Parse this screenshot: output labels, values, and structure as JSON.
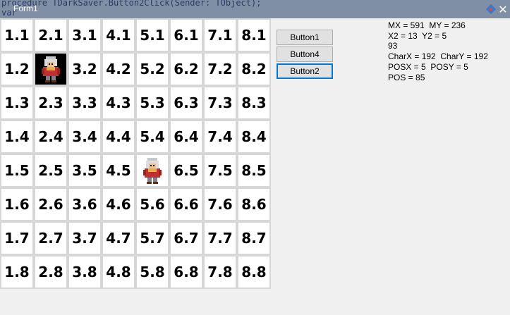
{
  "window": {
    "title": "Form1",
    "background_code": "procedure TDarkSaver.Button2Click(Sender: TObject);\nvar",
    "close_glyph": "✕"
  },
  "grid": {
    "cells": [
      "1.1",
      "2.1",
      "3.1",
      "4.1",
      "5.1",
      "6.1",
      "7.1",
      "8.1",
      "1.2",
      "",
      "3.2",
      "4.2",
      "5.2",
      "6.2",
      "7.2",
      "8.2",
      "1.3",
      "2.3",
      "3.3",
      "4.3",
      "5.3",
      "6.3",
      "7.3",
      "8.3",
      "1.4",
      "2.4",
      "3.4",
      "4.4",
      "5.4",
      "6.4",
      "7.4",
      "8.4",
      "1.5",
      "2.5",
      "3.5",
      "4.5",
      "",
      "6.5",
      "7.5",
      "8.5",
      "1.6",
      "2.6",
      "3.6",
      "4.6",
      "5.6",
      "6.6",
      "7.6",
      "8.6",
      "1.7",
      "2.7",
      "3.7",
      "4.7",
      "5.7",
      "6.7",
      "7.7",
      "8.7",
      "1.8",
      "2.8",
      "3.8",
      "4.8",
      "5.8",
      "6.8",
      "7.8",
      "8.8"
    ],
    "sprite_cells": [
      "2.2",
      "5.5"
    ],
    "dark_cell": "2.2"
  },
  "buttons": {
    "button1": "Button1",
    "button4": "Button4",
    "button2": "Button2"
  },
  "info": {
    "line1": "MX = 591  MY = 236",
    "line2": "X2 = 13  Y2 = 5",
    "line3": "93",
    "line4": "CharX = 192  CharY = 192",
    "line5": "POSX = 5  POSY = 5",
    "line6": "POS = 85"
  },
  "colors": {
    "titlebar": "#7f8fa6",
    "focus_border": "#0078d7"
  }
}
